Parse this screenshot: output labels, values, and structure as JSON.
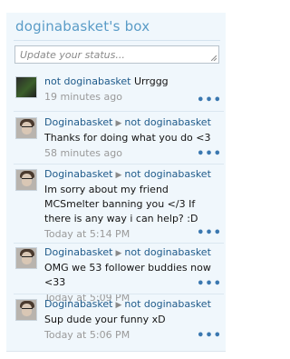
{
  "box": {
    "title": "doginabasket's box",
    "status_placeholder": "Update your status..."
  },
  "posts": [
    {
      "author": "not doginabasket",
      "recipient": "",
      "text": "Urrggg",
      "time": "19 minutes ago"
    },
    {
      "author": "Doginabasket",
      "recipient": "not doginabasket",
      "text": "Thanks for doing what you do <3",
      "time": "58 minutes ago"
    },
    {
      "author": "Doginabasket",
      "recipient": "not doginabasket",
      "text": "Im sorry about my friend MCSmelter banning you </3 If there is any way i can help? :D",
      "time": "Today at 5:14 PM"
    },
    {
      "author": "Doginabasket",
      "recipient": "not doginabasket",
      "text": "OMG we 53 follower buddies now <33",
      "time": "Today at 5:09 PM"
    },
    {
      "author": "Doginabasket",
      "recipient": "not doginabasket",
      "text": "Sup dude your funny xD",
      "time": "Today at 5:06 PM"
    }
  ],
  "icons": {
    "arrow": "▶",
    "more": "•••"
  }
}
